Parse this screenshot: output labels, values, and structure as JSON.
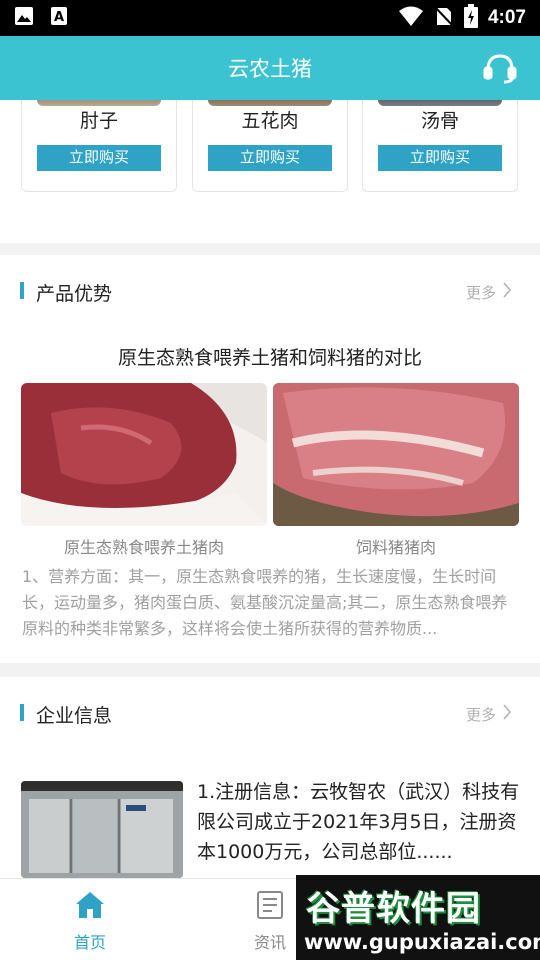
{
  "status_bar": {
    "time": "4:07",
    "icons": [
      "image-icon",
      "text-a-icon",
      "wifi-icon",
      "no-sim-icon",
      "battery-charging-icon"
    ]
  },
  "header": {
    "title": "云农土猪",
    "action_icon": "headset-icon"
  },
  "products": [
    {
      "name": "肘子",
      "buy_label": "立即购买"
    },
    {
      "name": "五花肉",
      "buy_label": "立即购买"
    },
    {
      "name": "汤骨",
      "buy_label": "立即购买"
    }
  ],
  "advantage": {
    "title": "产品优势",
    "more": "更多",
    "compare_title": "原生态熟食喂养土猪和饲料猪的对比",
    "left_caption": "原生态熟食喂养土猪肉",
    "right_caption": "饲料猪猪肉",
    "description": "1、营养方面：其一，原生态熟食喂养的猪，生长速度慢，生长时间长，运动量多，猪肉蛋白质、氨基酸沉淀量高;其二，原生态熟食喂养原料的种类非常繁多，这样将会使土猪所获得的营养物质..."
  },
  "company": {
    "title": "企业信息",
    "more": "更多",
    "text": "1.注册信息：云牧智农（武汉）科技有限公司成立于2021年3月5日，注册资本1000万元，公司总部位......"
  },
  "tabbar": {
    "tabs": [
      {
        "label": "首页",
        "icon": "home-icon",
        "active": true
      },
      {
        "label": "资讯",
        "icon": "document-icon",
        "active": false
      }
    ],
    "active_color": "#2ea3c5",
    "inactive_color": "#888888"
  },
  "watermark": {
    "logo_text": "谷普软件园",
    "url": "www.gupuxiazai.com"
  },
  "colors": {
    "header_bg": "#3cc3d2",
    "accent": "#2ea3c5"
  }
}
